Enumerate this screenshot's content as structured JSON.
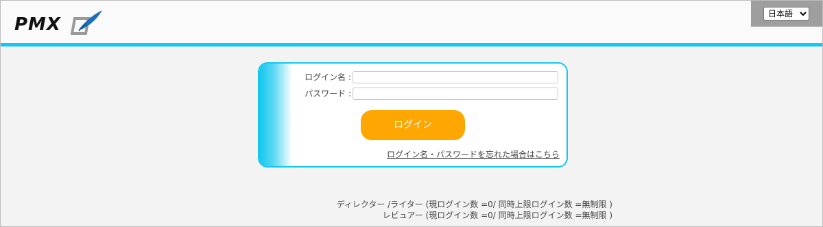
{
  "header": {
    "logo_text": "PMX",
    "language_select": {
      "selected": "日本語"
    }
  },
  "login": {
    "username_label": "ログイン名 :",
    "username_value": "",
    "password_label": "パスワード :",
    "password_value": "",
    "login_button": "ログイン",
    "forgot_link": "ログイン名・パスワードを忘れた場合はこちら"
  },
  "status": {
    "director_line": "ディレクター /ライター (現ログイン数 =0/ 同時上限ログイン数 =無制限 )",
    "reviewer_line": "レビュアー (現ログイン数 =0/ 同時上限ログイン数 =無制限 )"
  },
  "colors": {
    "accent": "#12c7f0",
    "button": "#fea601",
    "header_bg": "#fafafa",
    "page_bg": "#f3f3f3"
  }
}
